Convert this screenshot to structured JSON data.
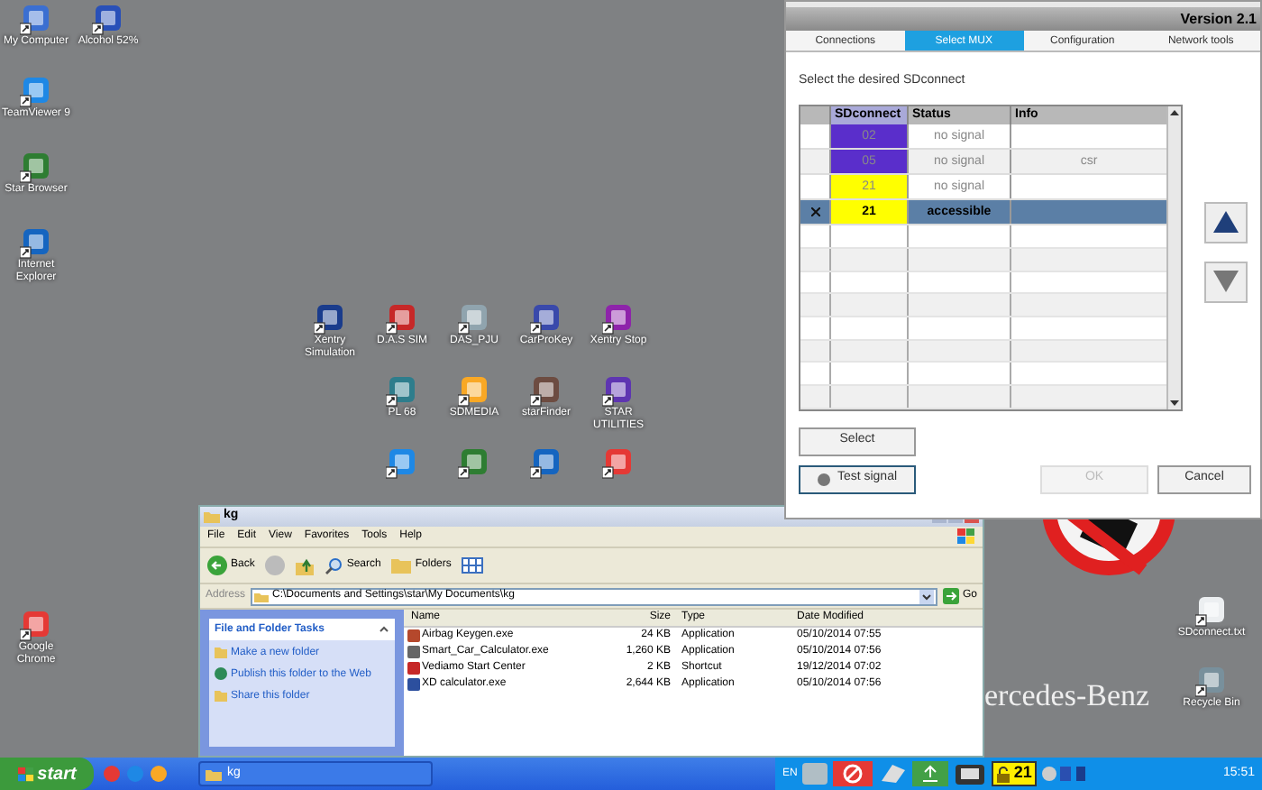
{
  "desktop": {
    "left_icons": [
      {
        "label": "My Computer"
      },
      {
        "label": "Alcohol 52%"
      },
      {
        "label": "TeamViewer 9"
      },
      {
        "label": "Star Browser"
      },
      {
        "label": "Internet Explorer"
      },
      {
        "label": "Google Chrome"
      }
    ],
    "center_icons": [
      {
        "label": "Xentry Simulation"
      },
      {
        "label": "D.A.S SIM"
      },
      {
        "label": "DAS_PJU"
      },
      {
        "label": "CarProKey"
      },
      {
        "label": "Xentry Stop"
      },
      {
        "label": "PL 68"
      },
      {
        "label": "SDMEDIA"
      },
      {
        "label": "starFinder"
      },
      {
        "label": "STAR UTILITIES"
      }
    ],
    "right_icons": [
      {
        "label": "SDconnect.txt"
      },
      {
        "label": "Recycle Bin"
      }
    ],
    "wallpaper_text": "ercedes-Benz"
  },
  "dialog": {
    "version": "Version 2.1",
    "tabs": [
      {
        "label": "Connections",
        "selected": false
      },
      {
        "label": "Select MUX",
        "selected": true
      },
      {
        "label": "Configuration",
        "selected": false
      },
      {
        "label": "Network tools",
        "selected": false
      }
    ],
    "prompt": "Select the desired SDconnect",
    "columns": [
      "SDconnect",
      "Status",
      "Info"
    ],
    "rows": [
      {
        "marked": false,
        "sdconnect": "02",
        "status": "no signal",
        "color": "#5a2ecb",
        "selected": false
      },
      {
        "marked": false,
        "sdconnect": "05",
        "status": "no signal",
        "info": "csr",
        "color": "#5a2ecb",
        "selected": false
      },
      {
        "marked": false,
        "sdconnect": "21",
        "status": "no signal",
        "color": "#ffff00",
        "selected": false
      },
      {
        "marked": true,
        "sdconnect": "21",
        "status": "accessible",
        "color": "#ffff00",
        "selected": true
      }
    ],
    "buttons": [
      {
        "label": "Select",
        "disabled": false
      },
      {
        "label": "Test signal",
        "disabled": false
      },
      {
        "label": "OK",
        "disabled": true
      },
      {
        "label": "Cancel",
        "disabled": false
      }
    ]
  },
  "explorer": {
    "title": "kg",
    "menu": [
      "File",
      "Edit",
      "View",
      "Favorites",
      "Tools",
      "Help"
    ],
    "toolbar": [
      "Back",
      "Search",
      "Folders"
    ],
    "address_label": "Address",
    "address": "C:\\Documents and Settings\\star\\My Documents\\kg",
    "go": "Go",
    "tasks_title": "File and Folder Tasks",
    "tasks": [
      "Make a new folder",
      "Publish this folder to the Web",
      "Share this folder"
    ],
    "columns": [
      "Name",
      "Size",
      "Type",
      "Date Modified"
    ],
    "files": [
      {
        "name": "Airbag Keygen.exe",
        "size": "24 KB",
        "type": "Application",
        "date": "05/10/2014 07:55"
      },
      {
        "name": "Smart_Car_Calculator.exe",
        "size": "1,260 KB",
        "type": "Application",
        "date": "05/10/2014 07:56"
      },
      {
        "name": "Vediamo Start Center",
        "size": "2 KB",
        "type": "Shortcut",
        "date": "19/12/2014 07:02"
      },
      {
        "name": "XD calculator.exe",
        "size": "2,644 KB",
        "type": "Application",
        "date": "05/10/2014 07:56"
      }
    ]
  },
  "taskbar": {
    "start": "start",
    "tasks": [
      {
        "label": "kg"
      }
    ],
    "language": "EN",
    "badge": "21",
    "clock": "15:51"
  }
}
